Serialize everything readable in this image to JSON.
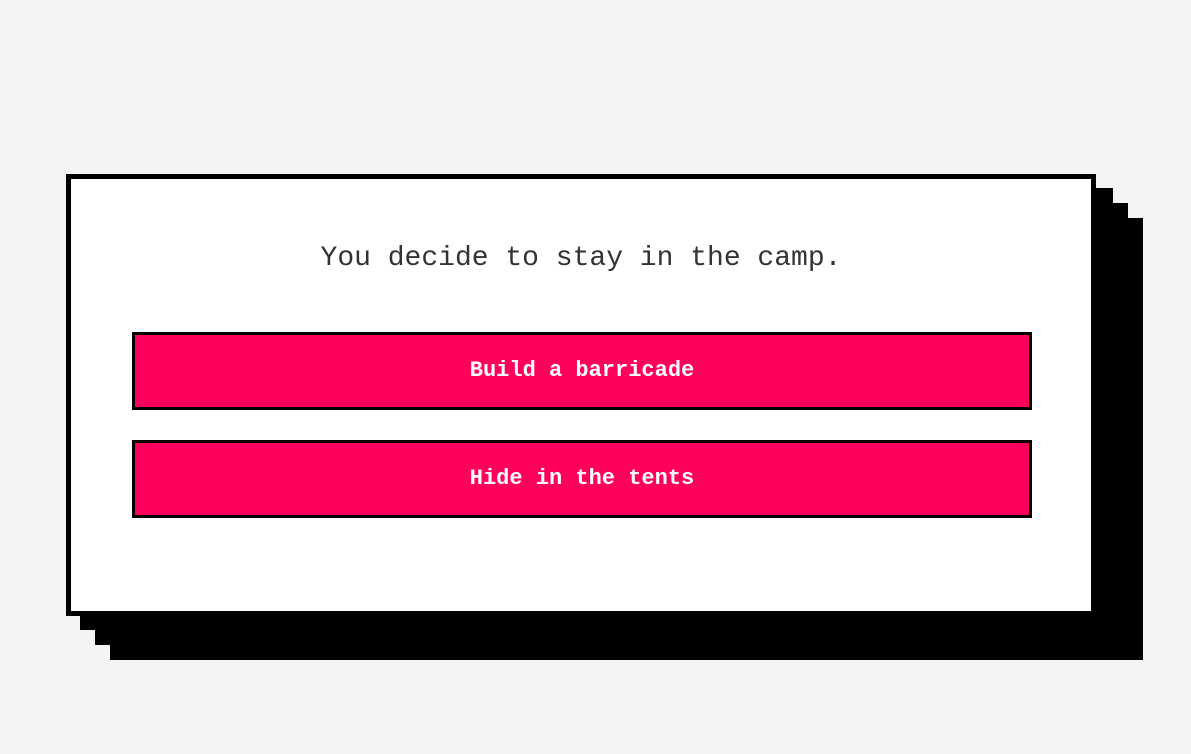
{
  "story": {
    "text": "You decide to stay in the camp."
  },
  "choices": [
    {
      "label": "Build a barricade"
    },
    {
      "label": "Hide in the tents"
    }
  ],
  "colors": {
    "background": "#f4f4f4",
    "card": "#ffffff",
    "shadow": "#000000",
    "button": "#ff005c",
    "button_text": "#ffffff",
    "text": "#333333"
  }
}
